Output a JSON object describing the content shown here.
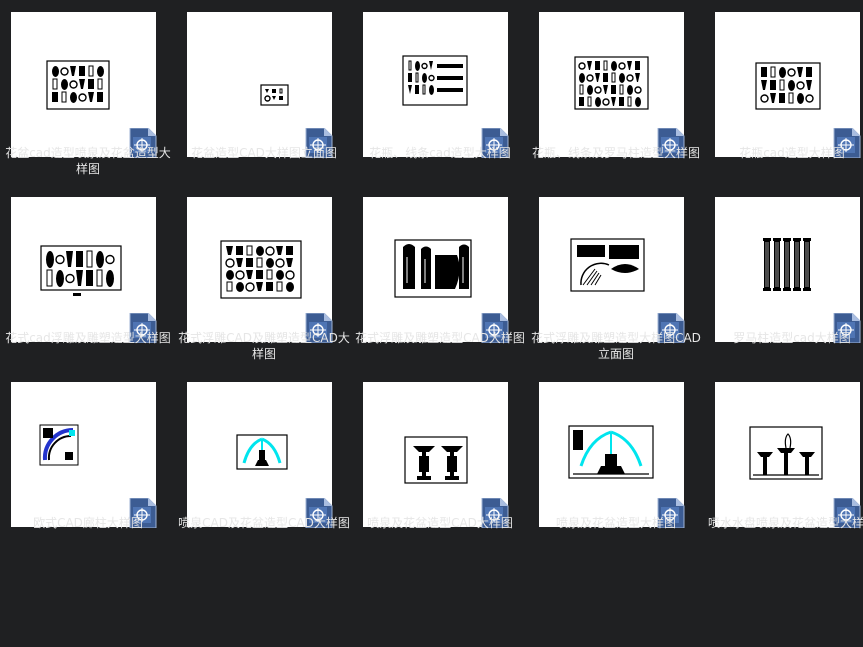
{
  "files": [
    {
      "label": "花盆cad造型喷泉及花盆造型大样图",
      "art": "pots"
    },
    {
      "label": "花盆造型CAD大样图立面图",
      "art": "small"
    },
    {
      "label": "花瓶、线条cad造型大样图",
      "art": "vase-lines"
    },
    {
      "label": "花瓶、线条及罗马柱造型大样图",
      "art": "many"
    },
    {
      "label": "花瓶cad造型大样图",
      "art": "vases"
    },
    {
      "label": "花式cad浮雕及雕塑造型大样图",
      "art": "statues"
    },
    {
      "label": "花式浮雕CAD及雕塑造型CAD大样图",
      "art": "reliefs"
    },
    {
      "label": "花式浮雕及雕塑造型CAD大样图",
      "art": "figures"
    },
    {
      "label": "花式浮雕及雕塑造型大样图CAD立面图",
      "art": "arch"
    },
    {
      "label": "罗马柱造型cad大样图",
      "art": "columns"
    },
    {
      "label": "欧式CAD廊柱大样图",
      "art": "colonnade"
    },
    {
      "label": "喷泉CAD及花盆造型CAD大样图",
      "art": "fountain1"
    },
    {
      "label": "喷泉及花盆造型CAD大样图",
      "art": "fountain2"
    },
    {
      "label": "喷泉及花盆造型大样图",
      "art": "fountain3"
    },
    {
      "label": "喷水水盘喷泉及花盆造型大样图",
      "art": "fountain4"
    }
  ],
  "file_icon": "cad-document-icon",
  "colors": {
    "background": "#1f2022",
    "caption": "#e6e6e6",
    "accent": "#00e5ee",
    "badge": "#3c5c93"
  }
}
